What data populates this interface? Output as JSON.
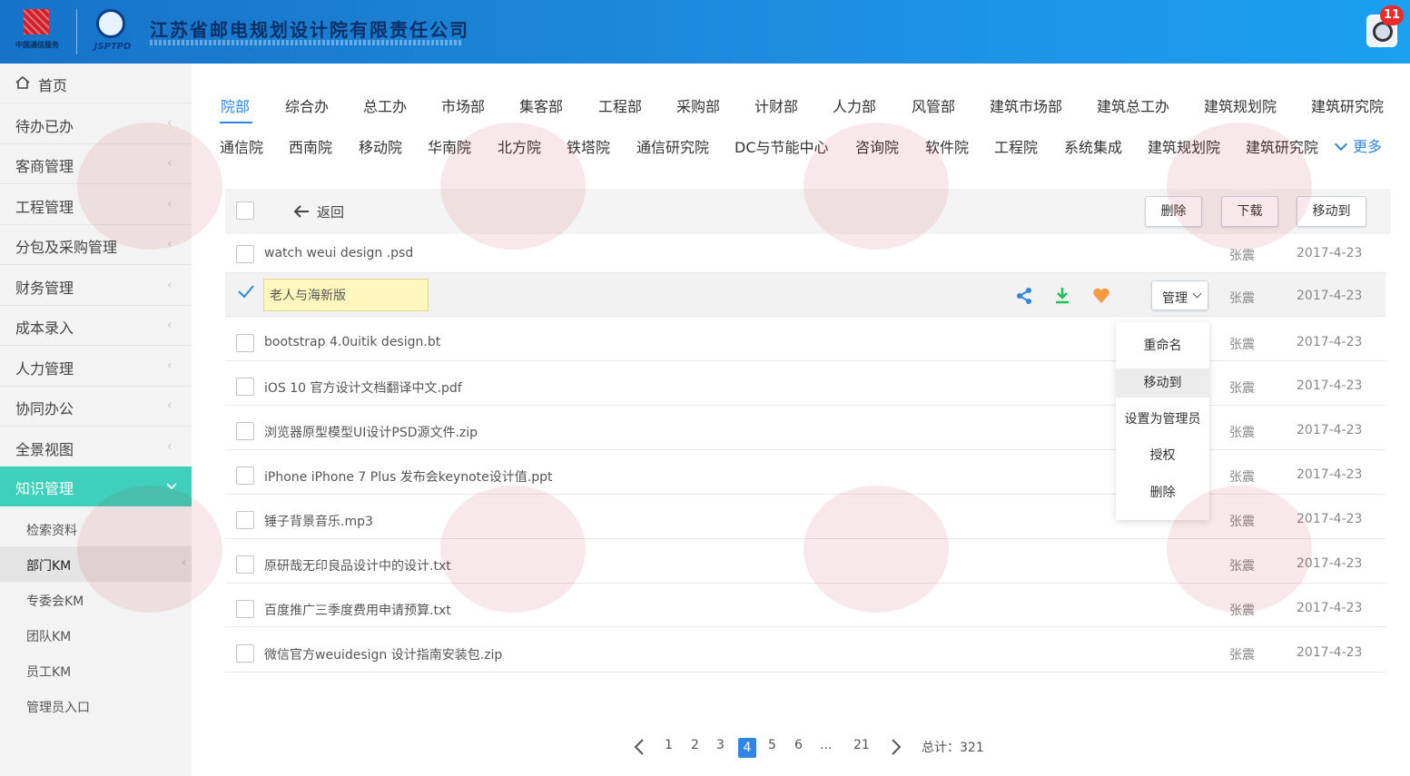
{
  "header": {
    "logo_text": "中国通信服务",
    "logo2_text": "JSPTPD",
    "company_name": "江苏省邮电规划设计院有限责任公司",
    "notification_count": "11"
  },
  "sidebar": {
    "home": "首页",
    "items": [
      "待办已办",
      "客商管理",
      "工程管理",
      "分包及采购管理",
      "财务管理",
      "成本录入",
      "人力管理",
      "协同办公",
      "全景视图"
    ],
    "active": "知识管理",
    "sub_items": [
      "检索资料",
      "部门KM",
      "专委会KM",
      "团队KM",
      "员工KM",
      "管理员入口"
    ]
  },
  "tabs_row1": [
    "院部",
    "综合办",
    "总工办",
    "市场部",
    "集客部",
    "工程部",
    "采购部",
    "计财部",
    "人力部",
    "风管部",
    "建筑市场部",
    "建筑总工办",
    "建筑规划院",
    "建筑研究院"
  ],
  "tabs_row2": [
    "通信院",
    "西南院",
    "移动院",
    "华南院",
    "北方院",
    "铁塔院",
    "通信研究院",
    "DC与节能中心",
    "咨询院",
    "软件院",
    "工程院",
    "系统集成",
    "建筑规划院",
    "建筑研究院"
  ],
  "more_label": "更多",
  "toolbar": {
    "back": "返回",
    "delete": "删除",
    "download": "下载",
    "move_to": "移动到"
  },
  "files": [
    {
      "name": "watch weui design .psd",
      "owner": "张震",
      "date": "2017-4-23"
    },
    {
      "name": "老人与海新版",
      "owner": "张震",
      "date": "2017-4-23"
    },
    {
      "name": "bootstrap 4.0uitik design.bt",
      "owner": "张震",
      "date": "2017-4-23"
    },
    {
      "name": "iOS 10 官方设计文档翻译中文.pdf",
      "owner": "张震",
      "date": "2017-4-23"
    },
    {
      "name": "浏览器原型模型UI设计PSD源文件.zip",
      "owner": "张震",
      "date": "2017-4-23"
    },
    {
      "name": "iPhone iPhone 7 Plus 发布会keynote设计值.ppt",
      "owner": "张震",
      "date": "2017-4-23"
    },
    {
      "name": "锤子背景音乐.mp3",
      "owner": "张震",
      "date": "2017-4-23"
    },
    {
      "name": "原研哉无印良品设计中的设计.txt",
      "owner": "张震",
      "date": "2017-4-23"
    },
    {
      "name": "百度推广三季度费用申请预算.txt",
      "owner": "张震",
      "date": "2017-4-23"
    },
    {
      "name": "微信官方weuidesign 设计指南安装包.zip",
      "owner": "张震",
      "date": "2017-4-23"
    }
  ],
  "manage_label": "管理",
  "manage_menu": [
    "重命名",
    "移动到",
    "设置为管理员",
    "授权",
    "删除"
  ],
  "pagination": {
    "pages": [
      "1",
      "2",
      "3",
      "4",
      "5",
      "6",
      "...",
      "21"
    ],
    "current": "4",
    "total": "总计：321"
  },
  "colors": {
    "accent": "#2f86e6",
    "active_menu": "#3ed0ba",
    "header": "#1e8fe0"
  }
}
